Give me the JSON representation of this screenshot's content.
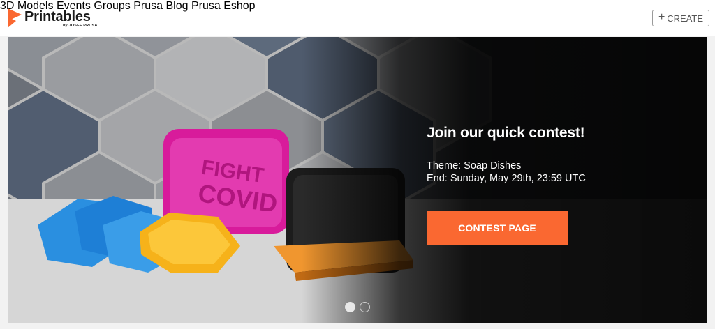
{
  "brand": {
    "name": "Printables",
    "byline": "by JOSEF PRUSA",
    "color": "#fa6831"
  },
  "nav": [
    {
      "label": "3D Models"
    },
    {
      "label": "Events"
    },
    {
      "label": "Groups"
    },
    {
      "label": "Prusa Blog"
    },
    {
      "label": "Prusa Eshop"
    }
  ],
  "header": {
    "create_label": "CREATE",
    "create_icon": "plus-icon"
  },
  "hero": {
    "title": "Join our quick contest!",
    "theme": "Theme: Soap Dishes",
    "end": "End: Sunday, May 29th, 23:59 UTC",
    "button_label": "CONTEST PAGE",
    "button_color": "#fa6831",
    "slides_total": 2,
    "active_slide": 1,
    "image_text": "FIGHT COVID"
  }
}
